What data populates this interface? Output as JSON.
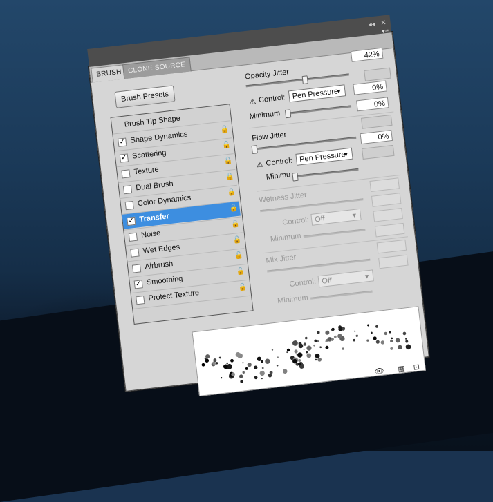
{
  "tabs": {
    "brush": "BRUSH",
    "clone_source": "CLONE SOURCE"
  },
  "window_controls": {
    "collapse": "◂◂",
    "close": "✕",
    "menu": "▾≡"
  },
  "brush_presets_label": "Brush Presets",
  "list": {
    "header": "Brush Tip Shape",
    "items": [
      {
        "label": "Shape Dynamics",
        "checked": true
      },
      {
        "label": "Scattering",
        "checked": true
      },
      {
        "label": "Texture",
        "checked": false
      },
      {
        "label": "Dual Brush",
        "checked": false
      },
      {
        "label": "Color Dynamics",
        "checked": false
      },
      {
        "label": "Transfer",
        "checked": true,
        "selected": true
      },
      {
        "label": "Noise",
        "checked": false
      },
      {
        "label": "Wet Edges",
        "checked": false
      },
      {
        "label": "Airbrush",
        "checked": false
      },
      {
        "label": "Smoothing",
        "checked": true
      },
      {
        "label": "Protect Texture",
        "checked": false
      }
    ]
  },
  "transfer": {
    "top_value": "42%",
    "opacity_jitter": {
      "label": "Opacity Jitter",
      "control_label": "Control:",
      "control_value": "Pen Pressure",
      "control_field": "0%",
      "minimum_label": "Minimum",
      "minimum_field": "0%",
      "warn": "⚠"
    },
    "flow_jitter": {
      "label": "Flow Jitter",
      "control_label": "Control:",
      "control_value": "Pen Pressure",
      "control_field": "0%",
      "minimum_label": "Minimu",
      "warn": "⚠"
    },
    "wetness_jitter": {
      "label": "Wetness Jitter",
      "control_label": "Control:",
      "control_value": "Off",
      "minimum_label": "Minimum"
    },
    "mix_jitter": {
      "label": "Mix Jitter",
      "control_label": "Control:",
      "control_value": "Off",
      "minimum_label": "Minimum"
    }
  },
  "check_mark": "✓",
  "lock_icon": "🔓",
  "bottom_icons": {
    "eye": "👁",
    "grid": "▦",
    "new": "⊡"
  }
}
